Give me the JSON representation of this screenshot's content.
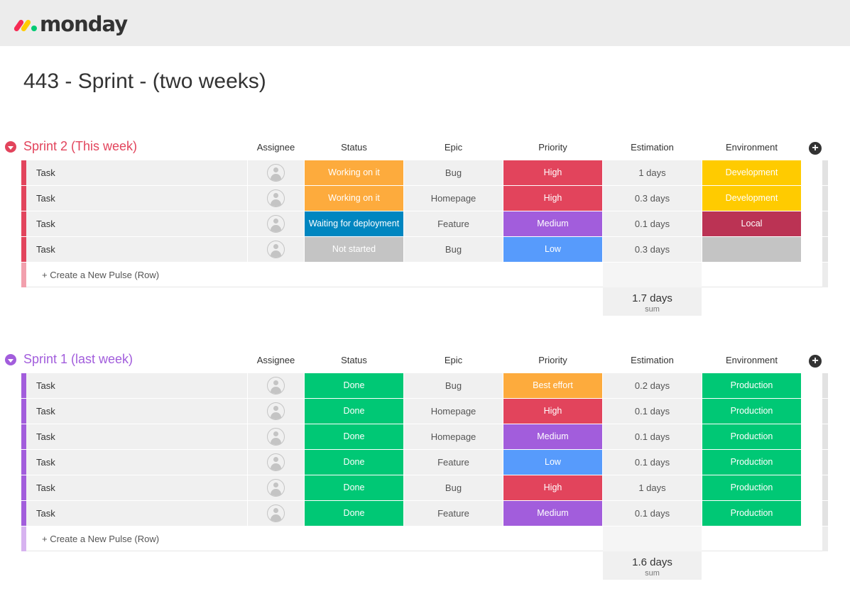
{
  "app": {
    "logo_text": "monday"
  },
  "page_title": "443 - Sprint - (two weeks)",
  "columns": [
    "Assignee",
    "Status",
    "Epic",
    "Priority",
    "Estimation",
    "Environment"
  ],
  "add_column_glyph": "+",
  "create_row_label": "+ Create a New Pulse (Row)",
  "colors": {
    "orange": "#fdab3d",
    "blue": "#0086c0",
    "grey": "#c4c4c4",
    "green": "#00c875",
    "red": "#e2445c",
    "purple": "#a25ddc",
    "lightblue": "#579bfc",
    "yellow": "#ffcb00",
    "darkred": "#bb3354",
    "sprint2": "#e2445c",
    "sprint1": "#a25ddc"
  },
  "groups": [
    {
      "title": "Sprint 2 (This week)",
      "color": "#e2445c",
      "create_stripe": "#f2a0ad",
      "rows": [
        {
          "name": "Task",
          "status": "Working on it",
          "status_color": "#fdab3d",
          "epic": "Bug",
          "priority": "High",
          "priority_color": "#e2445c",
          "estimation": "1 days",
          "environment": "Development",
          "env_color": "#ffcb00"
        },
        {
          "name": "Task",
          "status": "Working on it",
          "status_color": "#fdab3d",
          "epic": "Homepage",
          "priority": "High",
          "priority_color": "#e2445c",
          "estimation": "0.3 days",
          "environment": "Development",
          "env_color": "#ffcb00"
        },
        {
          "name": "Task",
          "status": "Waiting for deployment",
          "status_color": "#0086c0",
          "epic": "Feature",
          "priority": "Medium",
          "priority_color": "#a25ddc",
          "estimation": "0.1 days",
          "environment": "Local",
          "env_color": "#bb3354"
        },
        {
          "name": "Task",
          "status": "Not started",
          "status_color": "#c4c4c4",
          "epic": "Bug",
          "priority": "Low",
          "priority_color": "#579bfc",
          "estimation": "0.3 days",
          "environment": "",
          "env_color": "#c4c4c4"
        }
      ],
      "sum_value": "1.7 days",
      "sum_label": "sum"
    },
    {
      "title": "Sprint 1 (last week)",
      "color": "#a25ddc",
      "create_stripe": "#d7b3f0",
      "rows": [
        {
          "name": "Task",
          "status": "Done",
          "status_color": "#00c875",
          "epic": "Bug",
          "priority": "Best effort",
          "priority_color": "#fdab3d",
          "estimation": "0.2 days",
          "environment": "Production",
          "env_color": "#00c875"
        },
        {
          "name": "Task",
          "status": "Done",
          "status_color": "#00c875",
          "epic": "Homepage",
          "priority": "High",
          "priority_color": "#e2445c",
          "estimation": "0.1 days",
          "environment": "Production",
          "env_color": "#00c875"
        },
        {
          "name": "Task",
          "status": "Done",
          "status_color": "#00c875",
          "epic": "Homepage",
          "priority": "Medium",
          "priority_color": "#a25ddc",
          "estimation": "0.1 days",
          "environment": "Production",
          "env_color": "#00c875"
        },
        {
          "name": "Task",
          "status": "Done",
          "status_color": "#00c875",
          "epic": "Feature",
          "priority": "Low",
          "priority_color": "#579bfc",
          "estimation": "0.1 days",
          "environment": "Production",
          "env_color": "#00c875"
        },
        {
          "name": "Task",
          "status": "Done",
          "status_color": "#00c875",
          "epic": "Bug",
          "priority": "High",
          "priority_color": "#e2445c",
          "estimation": "1 days",
          "environment": "Production",
          "env_color": "#00c875"
        },
        {
          "name": "Task",
          "status": "Done",
          "status_color": "#00c875",
          "epic": "Feature",
          "priority": "Medium",
          "priority_color": "#a25ddc",
          "estimation": "0.1 days",
          "environment": "Production",
          "env_color": "#00c875"
        }
      ],
      "sum_value": "1.6 days",
      "sum_label": "sum"
    }
  ]
}
